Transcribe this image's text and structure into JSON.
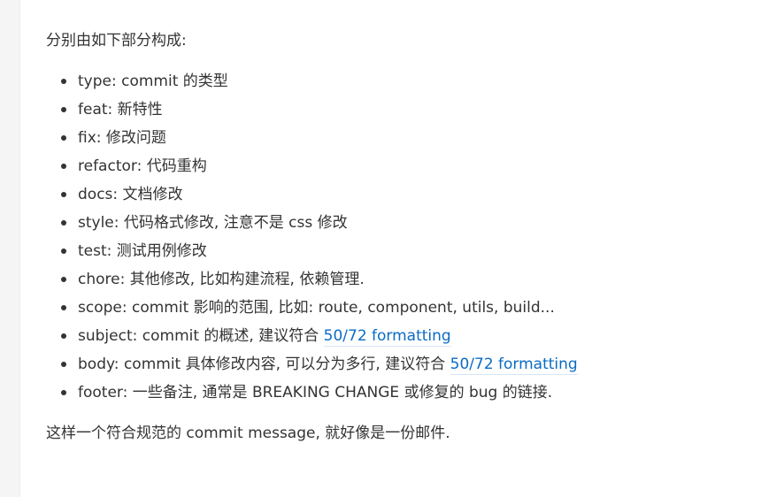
{
  "intro": "分别由如下部分构成:",
  "items": [
    {
      "key": "type:",
      "desc": " commit 的类型"
    },
    {
      "key": "feat:",
      "desc": " 新特性"
    },
    {
      "key": "fix:",
      "desc": " 修改问题"
    },
    {
      "key": "refactor:",
      "desc": " 代码重构"
    },
    {
      "key": "docs:",
      "desc": " 文档修改"
    },
    {
      "key": "style:",
      "desc": " 代码格式修改, 注意不是 css 修改"
    },
    {
      "key": "test:",
      "desc": " 测试用例修改"
    },
    {
      "key": "chore:",
      "desc": " 其他修改, 比如构建流程, 依赖管理."
    },
    {
      "key": "scope:",
      "desc": " commit 影响的范围, 比如: route, component, utils, build..."
    },
    {
      "key": "subject:",
      "desc": " commit 的概述, 建议符合 ",
      "link": "50/72 formatting"
    },
    {
      "key": "body:",
      "desc": " commit 具体修改内容, 可以分为多行, 建议符合 ",
      "link": "50/72 formatting"
    },
    {
      "key": "footer:",
      "desc": " 一些备注, 通常是 BREAKING CHANGE 或修复的 bug 的链接."
    }
  ],
  "outro": "这样一个符合规范的 commit message, 就好像是一份邮件.",
  "colors": {
    "text": "#333333",
    "link": "#0b6bc6",
    "gutter": "#f5f5f5"
  }
}
